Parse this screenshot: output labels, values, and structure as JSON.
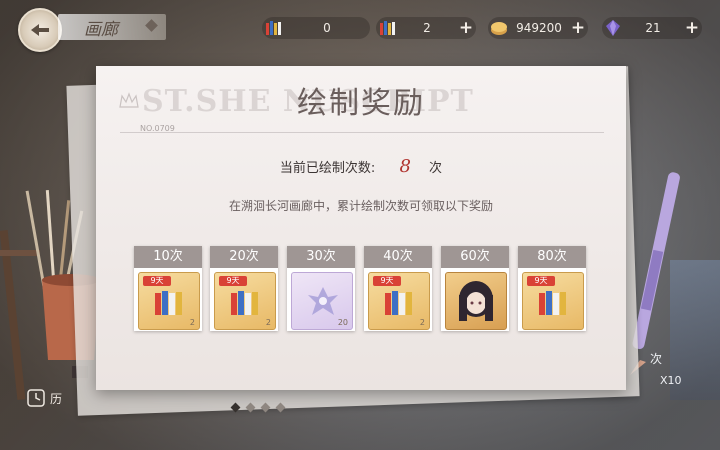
{
  "header": {
    "title": "画廊",
    "resources": [
      {
        "icon": "brush-set-icon",
        "value": "0",
        "has_plus": false
      },
      {
        "icon": "brush-set-icon",
        "value": "2",
        "has_plus": true
      },
      {
        "icon": "coin-icon",
        "value": "949200",
        "has_plus": true
      },
      {
        "icon": "crystal-icon",
        "value": "21",
        "has_plus": true
      }
    ],
    "plus_label": "+"
  },
  "panel": {
    "title": "绘制奖励",
    "watermark": "ST.SHE          NUSCRIPT",
    "form_no": "NO.0709",
    "count_label": "当前已绘制次数:",
    "count_value": "8",
    "count_unit": "次",
    "description": "在溯洄长河画廊中，累计绘制次数可领取以下奖励"
  },
  "rewards": [
    {
      "tier": "10次",
      "item": "paint-kit-icon",
      "day_tag": "9天",
      "qty": "2"
    },
    {
      "tier": "20次",
      "item": "paint-kit-icon",
      "day_tag": "9天",
      "qty": "2"
    },
    {
      "tier": "30次",
      "item": "sprite-icon",
      "day_tag": "",
      "qty": "20"
    },
    {
      "tier": "40次",
      "item": "paint-kit-icon",
      "day_tag": "9天",
      "qty": "2"
    },
    {
      "tier": "60次",
      "item": "character-portrait-icon",
      "day_tag": "",
      "qty": ""
    },
    {
      "tier": "80次",
      "item": "paint-kit-icon",
      "day_tag": "9天",
      "qty": ""
    }
  ],
  "pager": {
    "pages": 4,
    "active": 0
  },
  "background": {
    "history_label": "历",
    "right_label": "次",
    "right_x10": "X10"
  },
  "colors": {
    "tier_header": "#9f9694",
    "count_highlight": "#b0332f",
    "day_tag": "#d94236"
  }
}
